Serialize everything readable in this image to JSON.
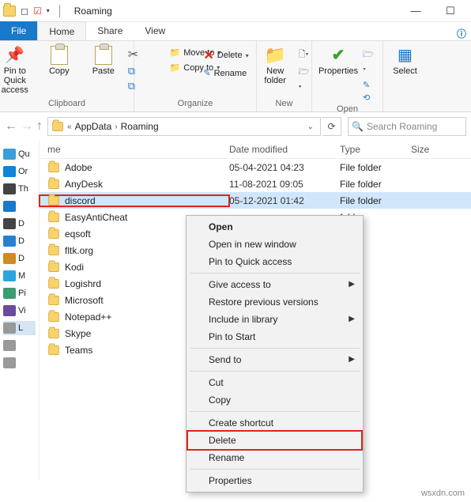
{
  "titlebar": {
    "title": "Roaming"
  },
  "tabs": {
    "file": "File",
    "home": "Home",
    "share": "Share",
    "view": "View"
  },
  "ribbon": {
    "pin": "Pin to Quick access",
    "copy": "Copy",
    "paste": "Paste",
    "clipboard_group": "Clipboard",
    "moveto": "Move to",
    "copyto": "Copy to",
    "delete": "Delete",
    "rename": "Rename",
    "organize_group": "Organize",
    "newfolder": "New folder",
    "new_group": "New",
    "properties": "Properties",
    "open_group": "Open",
    "select": "Select"
  },
  "breadcrumb": {
    "p1": "AppData",
    "p2": "Roaming",
    "search": "Search Roaming"
  },
  "columns": {
    "name": "me",
    "date": "Date modified",
    "type": "Type",
    "size": "Size"
  },
  "folders": [
    {
      "name": "Adobe",
      "date": "05-04-2021 04:23",
      "type": "File folder"
    },
    {
      "name": "AnyDesk",
      "date": "11-08-2021 09:05",
      "type": "File folder"
    },
    {
      "name": "discord",
      "date": "05-12-2021 01:42",
      "type": "File folder",
      "selected": true,
      "highlight": true
    },
    {
      "name": "EasyAntiCheat",
      "date": "",
      "type": "folder"
    },
    {
      "name": "eqsoft",
      "date": "",
      "type": "folder"
    },
    {
      "name": "fltk.org",
      "date": "",
      "type": "folder"
    },
    {
      "name": "Kodi",
      "date": "",
      "type": "folder"
    },
    {
      "name": "Logishrd",
      "date": "",
      "type": "folder"
    },
    {
      "name": "Microsoft",
      "date": "",
      "type": "folder"
    },
    {
      "name": "Notepad++",
      "date": "",
      "type": "folder"
    },
    {
      "name": "Skype",
      "date": "",
      "type": "folder"
    },
    {
      "name": "Teams",
      "date": "",
      "type": "folder"
    }
  ],
  "sidebar": [
    {
      "text": "Qu",
      "color": "#3c9dd8"
    },
    {
      "text": "Or",
      "color": "#1084d8"
    },
    {
      "text": "Th",
      "color": "#444"
    },
    {
      "text": "",
      "color": "#1979ca"
    },
    {
      "text": "D",
      "color": "#444"
    },
    {
      "text": "D",
      "color": "#2780d0"
    },
    {
      "text": "D",
      "color": "#d28b20"
    },
    {
      "text": "M",
      "color": "#2aa6de"
    },
    {
      "text": "Pi",
      "color": "#3d9b71"
    },
    {
      "text": "Vi",
      "color": "#6b4b9c"
    },
    {
      "text": "L",
      "color": "#999",
      "selected": true
    },
    {
      "text": "",
      "color": "#999"
    },
    {
      "text": "",
      "color": "#999"
    }
  ],
  "context": {
    "open": "Open",
    "open_new": "Open in new window",
    "pin_quick": "Pin to Quick access",
    "give_access": "Give access to",
    "restore": "Restore previous versions",
    "include": "Include in library",
    "pin_start": "Pin to Start",
    "send": "Send to",
    "cut": "Cut",
    "copy": "Copy",
    "shortcut": "Create shortcut",
    "delete": "Delete",
    "rename": "Rename",
    "properties": "Properties"
  },
  "watermark": "wsxdn.com"
}
